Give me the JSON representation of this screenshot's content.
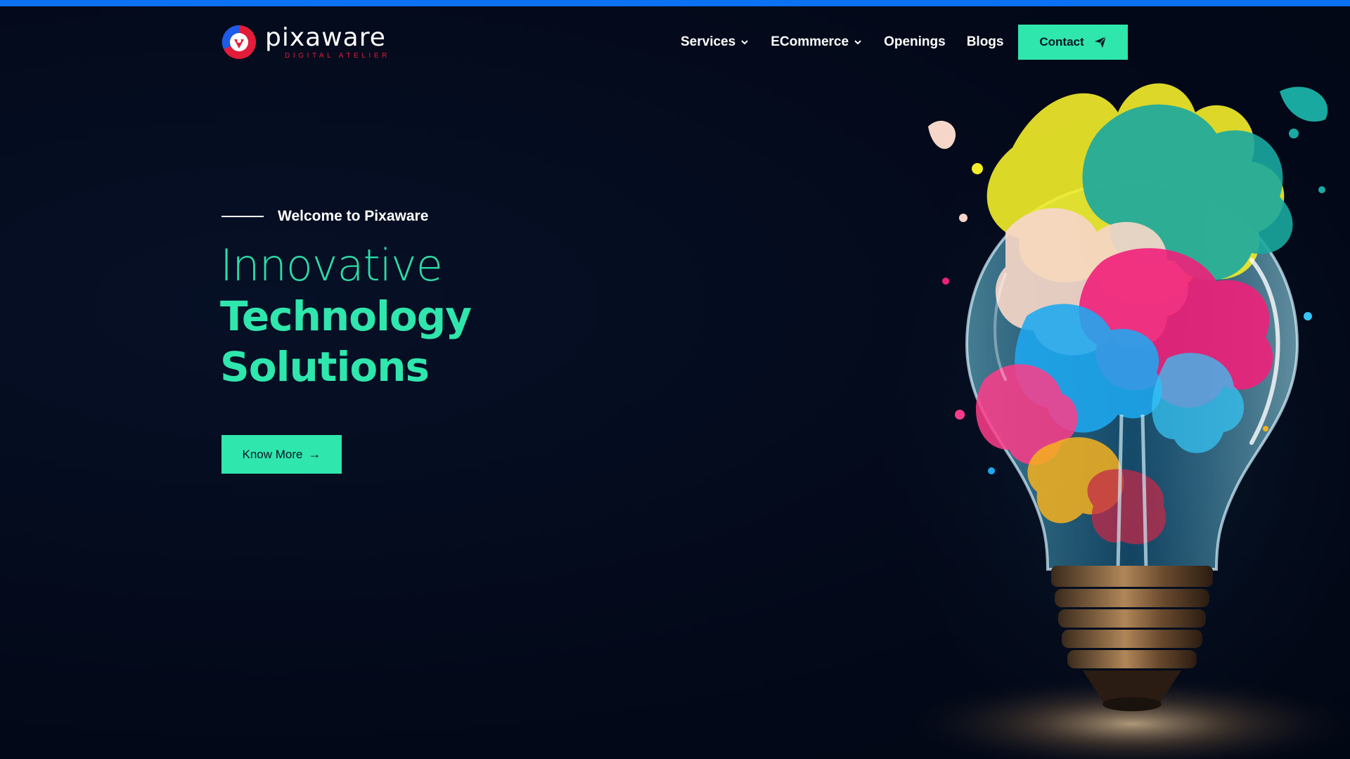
{
  "brand": {
    "name": "pixaware",
    "tagline": "DIGITAL ATELIER"
  },
  "nav": {
    "items": [
      {
        "label": "Services",
        "has_dropdown": true
      },
      {
        "label": "ECommerce",
        "has_dropdown": true
      },
      {
        "label": "Openings",
        "has_dropdown": false
      },
      {
        "label": "Blogs",
        "has_dropdown": false
      }
    ],
    "contact_label": "Contact"
  },
  "hero": {
    "eyebrow": "Welcome to Pixaware",
    "title_line1": "Innovative",
    "title_line2": "Technology",
    "title_line3": "Solutions",
    "cta_label": "Know More",
    "cta_arrow": "→"
  },
  "colors": {
    "accent": "#2fe6ac",
    "top_bar": "#0a72f2",
    "background": "#030919",
    "brand_red": "#e11d3a"
  },
  "icons": {
    "dropdown": "chevron-down-icon",
    "contact": "paper-plane-icon",
    "cta": "arrow-right-icon"
  }
}
